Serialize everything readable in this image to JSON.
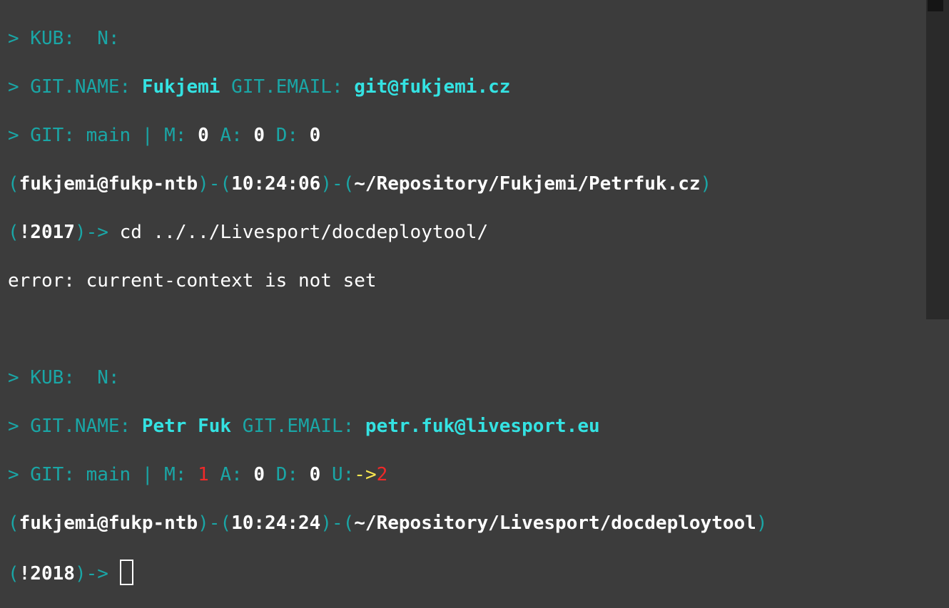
{
  "lines": {
    "l1": {
      "prefix": "> KUB:  N:"
    },
    "l2": {
      "k1": "> GIT.NAME: ",
      "v1": "Fukjemi",
      "k2": " GIT.EMAIL: ",
      "v2": "git@fukjemi.cz"
    },
    "l3": {
      "k1": "> GIT: main | M: ",
      "v1": "0",
      "k2": " A: ",
      "v2": "0",
      "k3": " D: ",
      "v3": "0"
    },
    "l4": {
      "p1": "(",
      "user": "fukjemi@fukp-ntb",
      "p2": ")-(",
      "time": "10:24:06",
      "p3": ")-(",
      "path": "~/Repository/Fukjemi/Petrfuk.cz",
      "p4": ")"
    },
    "l5": {
      "p1": "(",
      "hist": "!2017",
      "p2": ")-> ",
      "cmd": "cd ../../Livesport/docdeploytool/"
    },
    "l6": {
      "text": "error: current-context is not set"
    },
    "l8": {
      "prefix": "> KUB:  N:"
    },
    "l9": {
      "k1": "> GIT.NAME: ",
      "v1": "Petr Fuk",
      "k2": " GIT.EMAIL: ",
      "v2": "petr.fuk@livesport.eu"
    },
    "l10": {
      "k1": "> GIT: main | M: ",
      "v1": "1",
      "k2": " A: ",
      "v2": "0",
      "k3": " D: ",
      "v3": "0",
      "k4": " U:",
      "arrow": "->",
      "v4": "2"
    },
    "l11": {
      "p1": "(",
      "user": "fukjemi@fukp-ntb",
      "p2": ")-(",
      "time": "10:24:24",
      "p3": ")-(",
      "path": "~/Repository/Livesport/docdeploytool",
      "p4": ")"
    },
    "l12": {
      "p1": "(",
      "hist": "!2018",
      "p2": ")-> "
    }
  }
}
